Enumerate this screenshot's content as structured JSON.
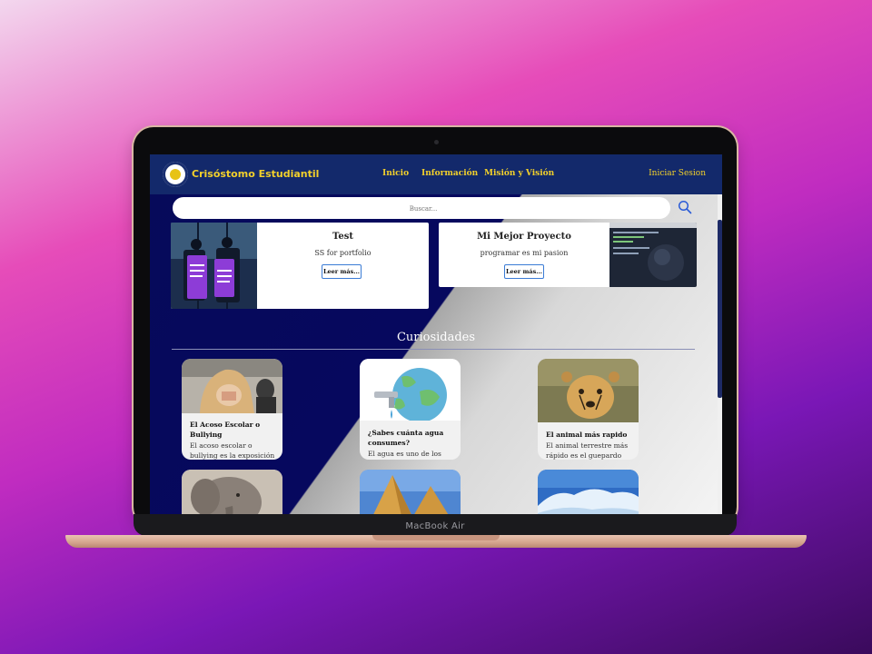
{
  "device": {
    "label": "MacBook Air"
  },
  "nav": {
    "brand": "Crisóstomo Estudiantil",
    "links": [
      "Inicio",
      "Información",
      "Misión y Visión"
    ],
    "login": "Iniciar Sesion"
  },
  "search": {
    "placeholder": "Buscar..."
  },
  "projects": [
    {
      "title": "Test",
      "description": "SS for portfolio",
      "button": "Leer más..."
    },
    {
      "title": "Mi Mejor Proyecto",
      "description": "programar es mi pasion",
      "button": "Leer más..."
    }
  ],
  "section": {
    "title": "Curiosidades"
  },
  "curiosities": [
    {
      "title": "El Acoso Escolar o Bullying",
      "text": "El acoso escolar o bullying es la exposición"
    },
    {
      "title": "¿Sabes cuánta agua consumes?",
      "text": "El agua es uno de los"
    },
    {
      "title": "El animal más rapido",
      "text": "El animal terrestre más rápido es el guepardo"
    },
    {
      "title": "",
      "text": ""
    },
    {
      "title": "",
      "text": ""
    },
    {
      "title": "",
      "text": ""
    }
  ],
  "colors": {
    "navbar": "#13296b",
    "accent_yellow": "#f2d02b",
    "page_dark": "#06085e",
    "button_border": "#3a7bd5"
  }
}
